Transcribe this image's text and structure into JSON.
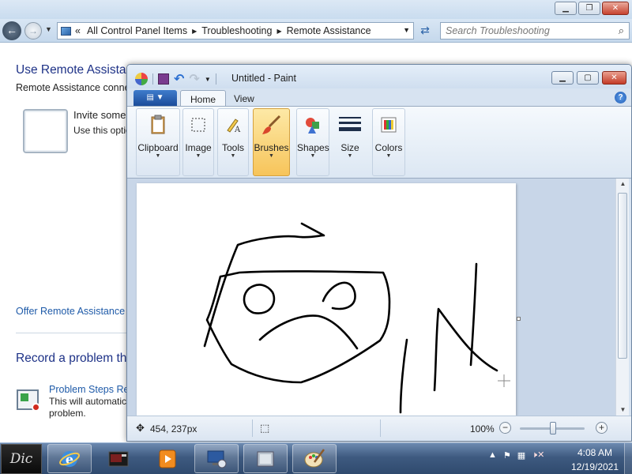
{
  "explorer": {
    "address": {
      "crumbs": [
        "All Control Panel Items",
        "Troubleshooting",
        "Remote Assistance"
      ],
      "overflow": "«"
    },
    "search": {
      "placeholder": "Search Troubleshooting"
    },
    "content": {
      "heading_remote": "Use Remote Assistan",
      "remote_subtitle": "Remote Assistance connec",
      "invite_title": "Invite some",
      "invite_desc": "Use this optio",
      "offer_link": "Offer Remote Assistance to",
      "heading_record": "Record a problem th",
      "psr_link": "Problem Steps Rec",
      "psr_desc_line1": "This will automatic",
      "psr_desc_line2": "problem."
    }
  },
  "paint": {
    "title": "Untitled - Paint",
    "tabs": [
      {
        "label": "Home",
        "active": true
      },
      {
        "label": "View",
        "active": false
      }
    ],
    "ribbon_groups": [
      {
        "label": "Clipboard",
        "icon": "clipboard-icon"
      },
      {
        "label": "Image",
        "icon": "image-select-icon"
      },
      {
        "label": "Tools",
        "icon": "tools-icon"
      },
      {
        "label": "Brushes",
        "icon": "brush-icon",
        "active": true
      },
      {
        "label": "Shapes",
        "icon": "shapes-icon"
      },
      {
        "label": "Size",
        "icon": "size-lines-icon"
      },
      {
        "label": "Colors",
        "icon": "colors-icon"
      }
    ],
    "status": {
      "cursor_position": "454, 237px",
      "zoom": "100%",
      "zoom_fraction": 0.5
    }
  },
  "taskbar": {
    "start_label": "Dic",
    "apps": [
      "internet-explorer-icon",
      "photo-app-icon",
      "media-player-icon",
      "remote-assistance-icon",
      "system-app-icon",
      "paint-icon"
    ],
    "clock": {
      "time": "4:08 AM",
      "date": "12/19/2021"
    }
  },
  "colors": {
    "link": "#1e5aa8",
    "heading": "#1e3287",
    "brushes_active": "#f7c45a",
    "taskbar": "#3e5a80"
  }
}
